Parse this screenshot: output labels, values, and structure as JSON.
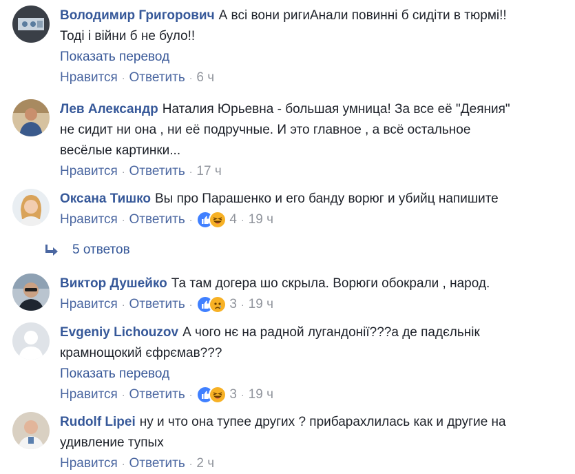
{
  "labels": {
    "like": "Нравится",
    "reply": "Ответить",
    "translate": "Показать перевод",
    "dot": "·"
  },
  "comments": [
    {
      "author": "Володимир Григорович",
      "lines": [
        "А всі вони ригиАнали повинні б сидіти в тюрмі!!",
        "Тоді і війни б не було!!"
      ],
      "show_translate": true,
      "reactions": [],
      "reaction_count": "",
      "time": "6 ч"
    },
    {
      "author": "Лев Александр",
      "lines": [
        "Наталия Юрьевна - большая умница! За все её \"Деяния\"",
        "не сидит ни она , ни её подручные. И это главное , а всё остальное",
        "весёлые картинки..."
      ],
      "show_translate": false,
      "reactions": [],
      "reaction_count": "",
      "time": "17 ч"
    },
    {
      "author": "Оксана Тишко",
      "lines": [
        "Вы про Парашенко и его банду ворюг и убийц напишите"
      ],
      "show_translate": false,
      "reactions": [
        "like",
        "haha"
      ],
      "reaction_count": "4",
      "time": "19 ч"
    },
    {
      "author": "Виктор Душейко",
      "lines": [
        "Та там догера шо скрыла. Ворюги обокрали , народ."
      ],
      "show_translate": false,
      "reactions": [
        "like",
        "sad"
      ],
      "reaction_count": "3",
      "time": "19 ч"
    },
    {
      "author": "Evgeniy Lichouzov",
      "lines": [
        "А чого нє на радной лугандонії???а де падєльнік",
        "крамнощокий єфрємав???"
      ],
      "show_translate": true,
      "reactions": [
        "like",
        "haha"
      ],
      "reaction_count": "3",
      "time": "19 ч"
    },
    {
      "author": "Rudolf Lipei",
      "lines": [
        "ну и что она тупее других ? прибарахлилась как и другие на",
        "удивление тупых"
      ],
      "show_translate": false,
      "reactions": [],
      "reaction_count": "",
      "time": "2 ч"
    }
  ],
  "replies": {
    "label": "5 ответов",
    "icon": "reply-arrow-icon"
  },
  "colors": {
    "author": "#365899",
    "link": "#4b67a1",
    "meta": "#90949c",
    "like": "#4080ff",
    "haha": "#f7b125"
  }
}
